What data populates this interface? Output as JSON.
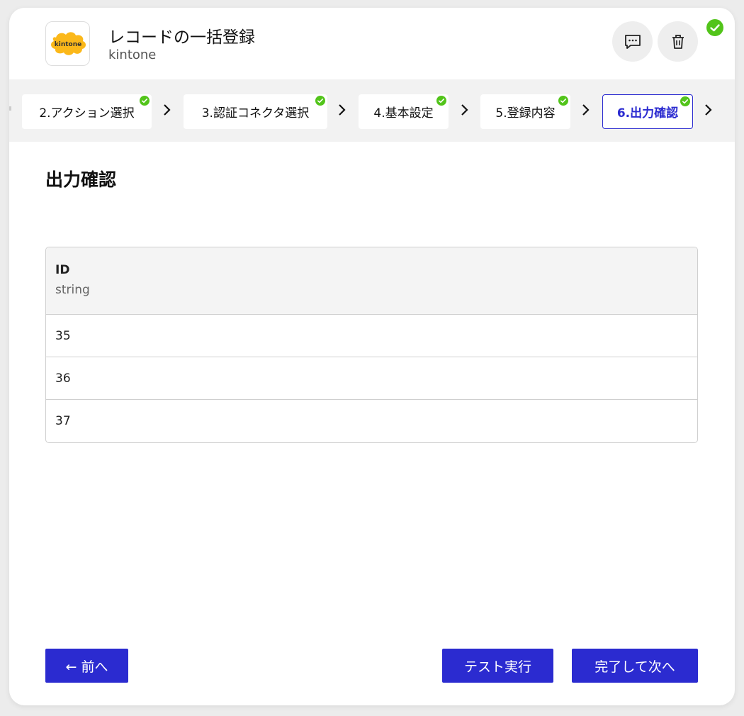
{
  "header": {
    "title": "レコードの一括登録",
    "subtitle": "kintone",
    "logo_text": "kintone",
    "comment_icon": "comment-icon",
    "trash_icon": "trash-icon",
    "status": "completed"
  },
  "steps": [
    {
      "label": "2.アクション選択",
      "done": true,
      "active": false
    },
    {
      "label": "3.認証コネクタ選択",
      "done": true,
      "active": false
    },
    {
      "label": "4.基本設定",
      "done": true,
      "active": false
    },
    {
      "label": "5.登録内容",
      "done": true,
      "active": false
    },
    {
      "label": "6.出力確認",
      "done": true,
      "active": true
    }
  ],
  "main": {
    "title": "出力確認",
    "table": {
      "column": {
        "name": "ID",
        "type": "string"
      },
      "rows": [
        "35",
        "36",
        "37"
      ]
    }
  },
  "footer": {
    "prev_label": "← 前へ",
    "test_label": "テスト実行",
    "next_label": "完了して次へ"
  },
  "colors": {
    "accent": "#2b2bd0",
    "success": "#52c41a",
    "logo_cloud": "#fbb81a"
  }
}
